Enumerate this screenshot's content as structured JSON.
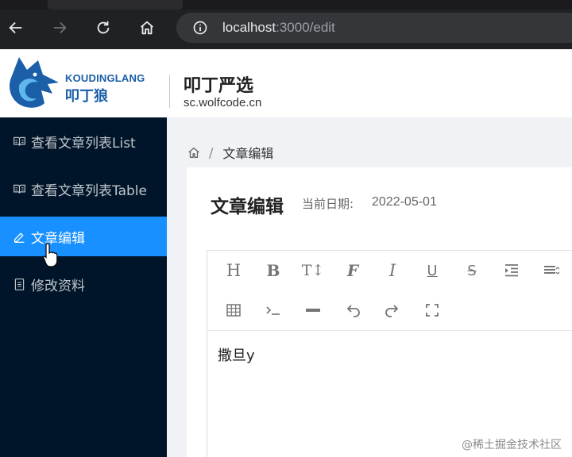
{
  "browser": {
    "url_host": "localhost",
    "url_path": ":3000/edit"
  },
  "header": {
    "brand_en": "KOUDINGLANG",
    "brand_cn": "叩丁狼",
    "site_title": "叩丁严选",
    "site_url": "sc.wolfcode.cn"
  },
  "sidebar": {
    "items": [
      {
        "label": "查看文章列表List",
        "icon": "book-icon",
        "active": false
      },
      {
        "label": "查看文章列表Table",
        "icon": "book-icon",
        "active": false
      },
      {
        "label": "文章编辑",
        "icon": "edit-icon",
        "active": true
      },
      {
        "label": "修改资料",
        "icon": "file-icon",
        "active": false
      }
    ]
  },
  "breadcrumb": {
    "separator": "/",
    "current": "文章编辑"
  },
  "page": {
    "title": "文章编辑",
    "date_label": "当前日期:",
    "date_value": "2022-05-01"
  },
  "toolbar": {
    "heading": "H",
    "bold": "B",
    "font_size": "T↕",
    "font_family": "F",
    "italic": "I",
    "underline": "U",
    "strike": "S"
  },
  "editor": {
    "content": "撒旦y"
  },
  "watermark": "@稀土掘金技术社区",
  "colors": {
    "sidebar_bg": "#001529",
    "active_item": "#1890ff",
    "browser_bg": "#202124",
    "brand_blue": "#1a5fa8"
  }
}
